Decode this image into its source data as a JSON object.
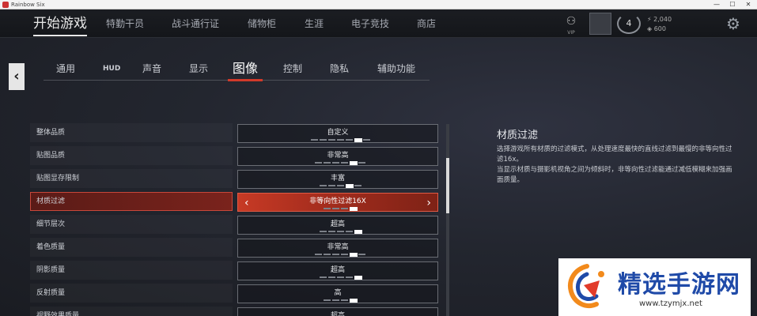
{
  "window": {
    "title": "Rainbow Six",
    "min": "—",
    "max": "☐",
    "close": "✕"
  },
  "topnav": {
    "tabs": [
      "开始游戏",
      "特勤干员",
      "战斗通行证",
      "储物柜",
      "生涯",
      "电子竞技",
      "商店"
    ],
    "vip_label": "VIP",
    "level": "4",
    "currency1": "2,040",
    "currency2": "600"
  },
  "back_icon": "‹",
  "subtabs": [
    "通用",
    "HUD",
    "声音",
    "显示",
    "图像",
    "控制",
    "隐私",
    "辅助功能"
  ],
  "active_subtab_index": 4,
  "settings": [
    {
      "label": "整体品质",
      "value": "自定义",
      "level": 6,
      "pips": 7
    },
    {
      "label": "贴图品质",
      "value": "非常高",
      "level": 5,
      "pips": 6
    },
    {
      "label": "贴图显存限制",
      "value": "丰富",
      "level": 4,
      "pips": 5
    },
    {
      "label": "材质过滤",
      "value": "非等向性过滤16X",
      "level": 4,
      "pips": 4,
      "selected": true
    },
    {
      "label": "细节层次",
      "value": "超高",
      "level": 5,
      "pips": 5
    },
    {
      "label": "着色质量",
      "value": "非常高",
      "level": 5,
      "pips": 6
    },
    {
      "label": "阴影质量",
      "value": "超高",
      "level": 5,
      "pips": 5
    },
    {
      "label": "反射质量",
      "value": "高",
      "level": 4,
      "pips": 4
    },
    {
      "label": "视野效果质量",
      "value": "超高",
      "level": 5,
      "pips": 5
    }
  ],
  "arrows": {
    "left": "‹",
    "right": "›"
  },
  "description": {
    "title": "材质过滤",
    "lines": [
      "选择游戏所有材质的过滤模式，从处理速度最快的直线过滤到最慢的非等向性过滤16x。",
      "当显示材质与摄影机视角之间为倾斜时，非等向性过滤能通过减低模糊来加强画面质量。"
    ]
  },
  "watermark": {
    "name": "精选手游网",
    "url": "www.tzymjx.net",
    "colors": {
      "orange": "#f28a1c",
      "blue": "#1f4aa8",
      "red": "#e23b2a"
    }
  },
  "colors": {
    "accent": "#d23a2a"
  }
}
